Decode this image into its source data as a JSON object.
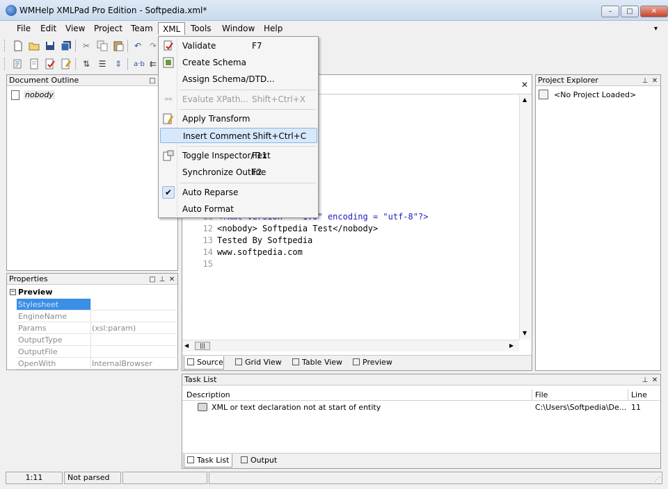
{
  "window": {
    "title": "WMHelp XMLPad Pro Edition - Softpedia.xml*",
    "min_label": "–",
    "max_label": "□",
    "close_label": "✕"
  },
  "menubar": {
    "items": [
      {
        "label": "File"
      },
      {
        "label": "Edit"
      },
      {
        "label": "View"
      },
      {
        "label": "Project"
      },
      {
        "label": "Team"
      },
      {
        "label": "XML"
      },
      {
        "label": "Tools"
      },
      {
        "label": "Window"
      },
      {
        "label": "Help"
      }
    ],
    "overflow": "▾"
  },
  "xml_menu": {
    "items": [
      {
        "label": "Validate",
        "shortcut": "F7"
      },
      {
        "label": "Create Schema",
        "shortcut": ""
      },
      {
        "label": "Assign Schema/DTD...",
        "shortcut": ""
      },
      {
        "label": "Evalute XPath...",
        "shortcut": "Shift+Ctrl+X"
      },
      {
        "label": "Apply Transform",
        "shortcut": ""
      },
      {
        "label": "Insert Comment",
        "shortcut": "Shift+Ctrl+C"
      },
      {
        "label": "Toggle Inspector/Text",
        "shortcut": "F11"
      },
      {
        "label": "Synchronize Outline",
        "shortcut": "F2"
      },
      {
        "label": "Auto Reparse",
        "shortcut": ""
      },
      {
        "label": "Auto Format",
        "shortcut": ""
      }
    ],
    "check_mark": "✔"
  },
  "toolbar": {
    "text_icon": "a·b"
  },
  "document_outline": {
    "title": "Document Outline",
    "node": "nobody"
  },
  "properties": {
    "title": "Properties",
    "section": "Preview",
    "rows": [
      {
        "name": "Stylesheet",
        "value": ""
      },
      {
        "name": "EngineName",
        "value": ""
      },
      {
        "name": "Params",
        "value": "(xsl:param)"
      },
      {
        "name": "OutputType",
        "value": ""
      },
      {
        "name": "OutputFile",
        "value": ""
      },
      {
        "name": "OpenWith",
        "value": "InternalBrowser"
      }
    ]
  },
  "editor": {
    "lines": [
      {
        "num": "11",
        "text": "<?xml version = \"1.0\" encoding = \"utf-8\"?>"
      },
      {
        "num": "12",
        "text": "<nobody> Softpedia Test</nobody>"
      },
      {
        "num": "13",
        "text": "Tested By Softpedia"
      },
      {
        "num": "14",
        "text": "www.softpedia.com"
      },
      {
        "num": "15",
        "text": ""
      }
    ],
    "tabs": [
      {
        "label": "Source"
      },
      {
        "label": "Grid View"
      },
      {
        "label": "Table View"
      },
      {
        "label": "Preview"
      }
    ],
    "close_label": "✕"
  },
  "project_explorer": {
    "title": "Project Explorer",
    "node": "<No Project Loaded>"
  },
  "task_list": {
    "title": "Task List",
    "columns": [
      "Description",
      "File",
      "Line"
    ],
    "rows": [
      {
        "description": "XML or text declaration not at start of entity",
        "file": "C:\\Users\\Softpedia\\De...",
        "line": "11"
      }
    ],
    "tabs": [
      {
        "label": "Task List"
      },
      {
        "label": "Output"
      }
    ]
  },
  "statusbar": {
    "position": "1:11",
    "parse_state": "Not parsed",
    "cell3": "",
    "cell4": ""
  },
  "colors": {
    "accent": "#d7e8fb",
    "tag_blue": "#2020c0",
    "line_number_gray": "#9a9a9a"
  }
}
